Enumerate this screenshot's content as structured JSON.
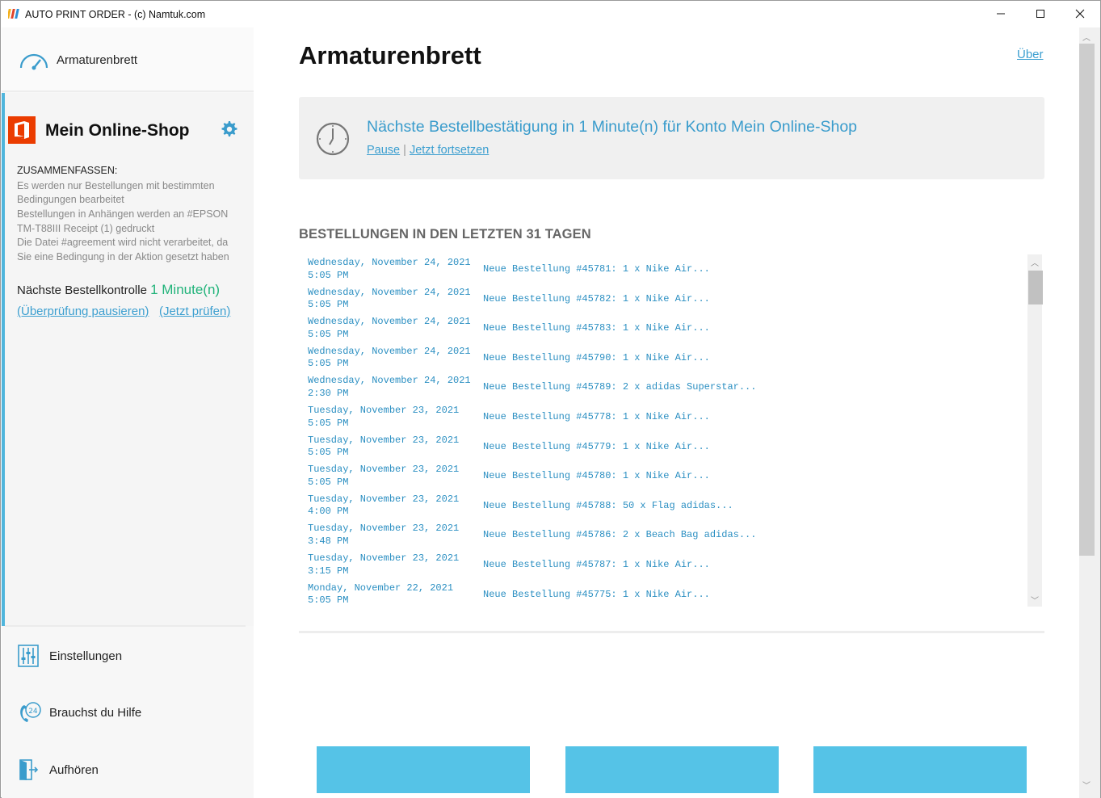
{
  "window": {
    "title": "AUTO PRINT ORDER - (c) Namtuk.com",
    "minimize_glyph": "—",
    "maximize_glyph": "☐",
    "close_glyph": "✕"
  },
  "sidebar": {
    "dashboard_label": "Armaturenbrett",
    "shop": {
      "name": "Mein Online-Shop",
      "summary_title": "ZUSAMMENFASSEN:",
      "summary_lines": [
        "Es werden nur Bestellungen mit bestimmten",
        "Bedingungen bearbeitet",
        "Bestellungen in Anhängen werden an #EPSON",
        "TM-T88III Receipt (1) gedruckt",
        "Die Datei #agreement wird nicht verarbeitet, da",
        "Sie eine Bedingung in der Aktion gesetzt haben"
      ],
      "next_check_label": "Nächste Bestellkontrolle",
      "next_check_value": "1 Minute(n)",
      "pause_link": "(Überprüfung pausieren)",
      "check_now_link": "(Jetzt prüfen)"
    },
    "settings_label": "Einstellungen",
    "help_label": "Brauchst du Hilfe",
    "quit_label": "Aufhören"
  },
  "main": {
    "title": "Armaturenbrett",
    "about_link": "Über",
    "notice": {
      "headline": "Nächste Bestellbestätigung in 1 Minute(n) für Konto Mein Online-Shop",
      "pause": "Pause",
      "separator": "|",
      "resume": "Jetzt fortsetzen"
    },
    "orders_title": "BESTELLUNGEN IN DEN LETZTEN 31 TAGEN",
    "orders": [
      {
        "date": "Wednesday, November 24, 2021",
        "time": "5:05 PM",
        "desc": "Neue Bestellung #45781: 1 x Nike Air..."
      },
      {
        "date": "Wednesday, November 24, 2021",
        "time": "5:05 PM",
        "desc": "Neue Bestellung #45782: 1 x Nike Air..."
      },
      {
        "date": "Wednesday, November 24, 2021",
        "time": "5:05 PM",
        "desc": "Neue Bestellung #45783: 1 x Nike Air..."
      },
      {
        "date": "Wednesday, November 24, 2021",
        "time": "5:05 PM",
        "desc": "Neue Bestellung #45790: 1 x Nike Air..."
      },
      {
        "date": "Wednesday, November 24, 2021",
        "time": "2:30 PM",
        "desc": "Neue Bestellung #45789: 2 x adidas Superstar..."
      },
      {
        "date": "Tuesday, November 23, 2021",
        "time": "5:05 PM",
        "desc": "Neue Bestellung #45778: 1 x Nike Air..."
      },
      {
        "date": "Tuesday, November 23, 2021",
        "time": "5:05 PM",
        "desc": "Neue Bestellung #45779: 1 x Nike Air..."
      },
      {
        "date": "Tuesday, November 23, 2021",
        "time": "5:05 PM",
        "desc": "Neue Bestellung #45780: 1 x Nike Air..."
      },
      {
        "date": "Tuesday, November 23, 2021",
        "time": "4:00 PM",
        "desc": "Neue Bestellung #45788: 50 x Flag adidas..."
      },
      {
        "date": "Tuesday, November 23, 2021",
        "time": "3:48 PM",
        "desc": "Neue Bestellung #45786: 2 x Beach Bag adidas..."
      },
      {
        "date": "Tuesday, November 23, 2021",
        "time": "3:15 PM",
        "desc": "Neue Bestellung #45787: 1 x Nike Air..."
      },
      {
        "date": "Monday, November 22, 2021",
        "time": "5:05 PM",
        "desc": "Neue Bestellung #45775: 1 x Nike Air..."
      }
    ],
    "scroll_up_glyph": "︿",
    "scroll_down_glyph": "﹀"
  },
  "colors": {
    "accent": "#4fb5dc",
    "link": "#3c9fd0",
    "success": "#21b37a",
    "brand_office": "#eb3c00",
    "action_button": "#55c3e7"
  }
}
